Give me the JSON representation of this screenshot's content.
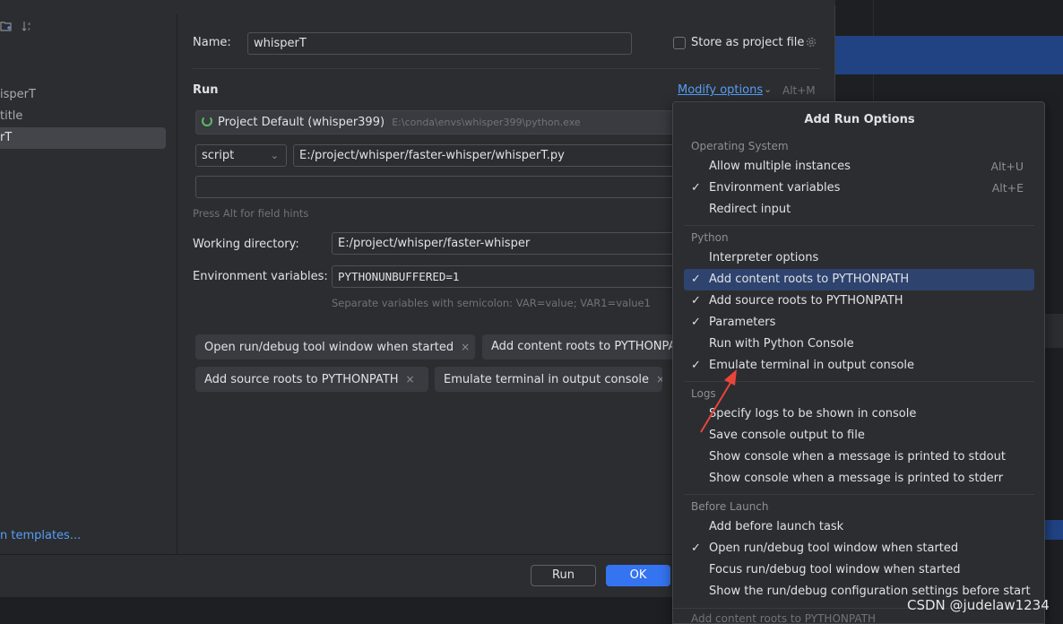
{
  "left_panel": {
    "items": [
      {
        "label": "isperT"
      },
      {
        "label": "title"
      },
      {
        "label": "rT"
      }
    ],
    "templates_link": "n templates..."
  },
  "form": {
    "name_label": "Name:",
    "name_value": "whisperT",
    "store_label": "Store as project file",
    "run_section": "Run",
    "modify_options": "Modify options",
    "modify_shortcut": "Alt+M",
    "interpreter_name": "Project Default (whisper399)",
    "interpreter_path": "E:\\conda\\envs\\whisper399\\python.exe",
    "script_type": "script",
    "script_path": "E:/project/whisper/faster-whisper/whisperT.py",
    "params_value": "",
    "field_hint": "Press Alt for field hints",
    "working_dir_label": "Working directory:",
    "working_dir_value": "E:/project/whisper/faster-whisper",
    "env_label": "Environment variables:",
    "env_value": "PYTHONUNBUFFERED=1",
    "env_hint": "Separate variables with semicolon: VAR=value; VAR1=value1",
    "chips": [
      {
        "label": "Open run/debug tool window when started"
      },
      {
        "label": "Add content roots to PYTHONPATH"
      },
      {
        "label": "Add source roots to PYTHONPATH"
      },
      {
        "label": "Emulate terminal in output console"
      }
    ],
    "chip_close": "×"
  },
  "buttons": {
    "run": "Run",
    "ok": "OK"
  },
  "popup": {
    "title": "Add Run Options",
    "groups": {
      "os": "Operating System",
      "python": "Python",
      "logs": "Logs",
      "before_launch": "Before Launch"
    },
    "check": "✓",
    "options": {
      "allow_multiple": {
        "label": "Allow multiple instances",
        "shortcut": "Alt+U"
      },
      "env_vars": {
        "label": "Environment variables",
        "shortcut": "Alt+E"
      },
      "redirect_input": {
        "label": "Redirect input"
      },
      "interpreter_options": {
        "label": "Interpreter options"
      },
      "content_roots": {
        "label": "Add content roots to PYTHONPATH"
      },
      "source_roots": {
        "label": "Add source roots to PYTHONPATH"
      },
      "parameters": {
        "label": "Parameters"
      },
      "python_console": {
        "label": "Run with Python Console"
      },
      "emulate_terminal": {
        "label": "Emulate terminal in output console"
      },
      "specify_logs": {
        "label": "Specify logs to be shown in console"
      },
      "save_output": {
        "label": "Save console output to file"
      },
      "show_stdout": {
        "label": "Show console when a message is printed to stdout"
      },
      "show_stderr": {
        "label": "Show console when a message is printed to stderr"
      },
      "add_before_launch": {
        "label": "Add before launch task"
      },
      "open_tool_window": {
        "label": "Open run/debug tool window when started"
      },
      "focus_tool_window": {
        "label": "Focus run/debug tool window when started"
      },
      "show_settings": {
        "label": "Show the run/debug configuration settings before start"
      }
    },
    "footer": "Add content roots to PYTHONPATH"
  },
  "watermark": "CSDN @judelaw1234",
  "colors": {
    "accent": "#3574f0",
    "link": "#589df6",
    "selection": "#2e436e",
    "annotation_arrow": "#e8453c"
  }
}
